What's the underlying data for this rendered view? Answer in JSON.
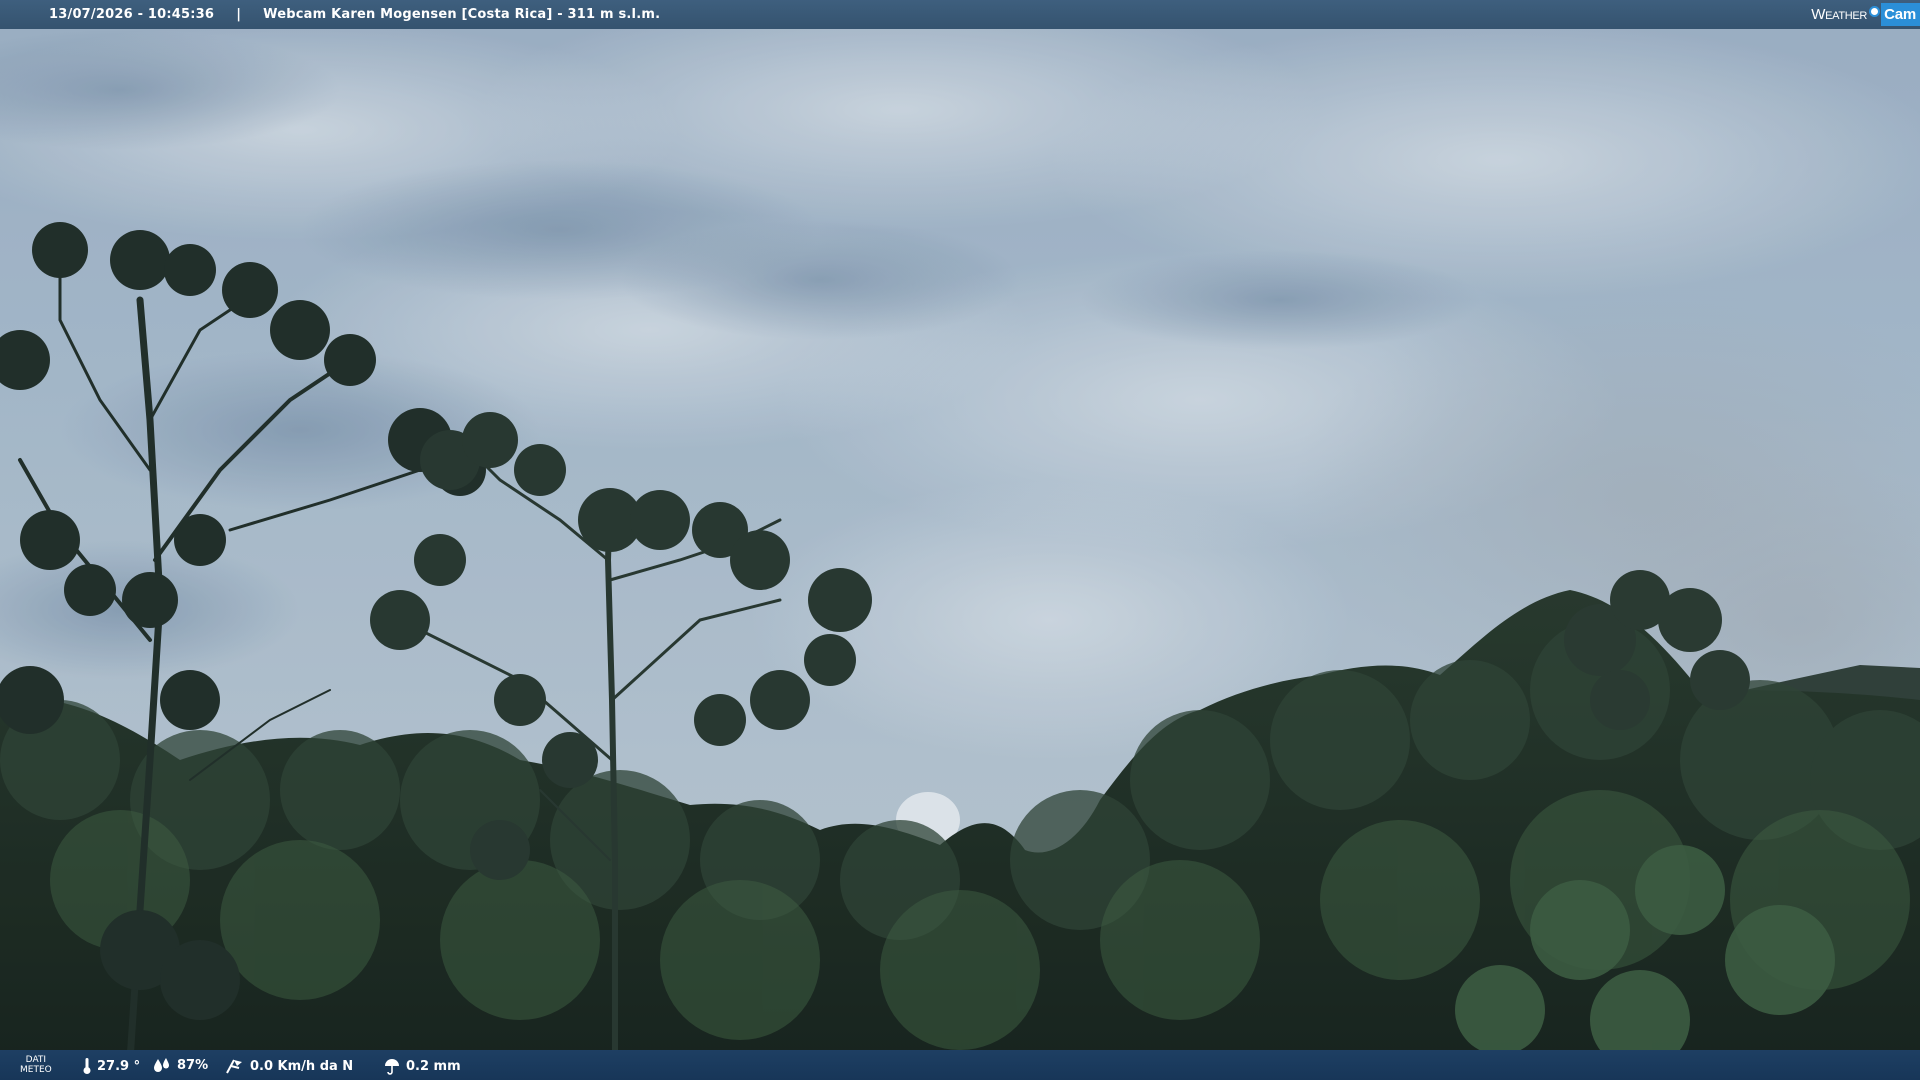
{
  "overlay": {
    "timestamp": "13/07/2026 - 10:45:36",
    "separator": "|",
    "title": "Webcam Karen Mogensen [Costa Rica] - 311 m s.l.m.",
    "logo": {
      "left": "Weather",
      "right": "Cam",
      "accent_color": "#2b8fd8"
    }
  },
  "weather": {
    "label_line1": "DATI",
    "label_line2": "METEO",
    "temperature": "27.9 °",
    "humidity": "87%",
    "wind": "0.0 Km/h da N",
    "rain": "0.2 mm",
    "icons": [
      "thermometer-icon",
      "humidity-drops-icon",
      "wind-icon",
      "rain-umbrella-icon"
    ]
  },
  "colors": {
    "top_bar": "#3e5f7e",
    "bottom_bar": "#1e3f63",
    "sky": "#8fa6bd",
    "forest": "#1b2a1e"
  }
}
